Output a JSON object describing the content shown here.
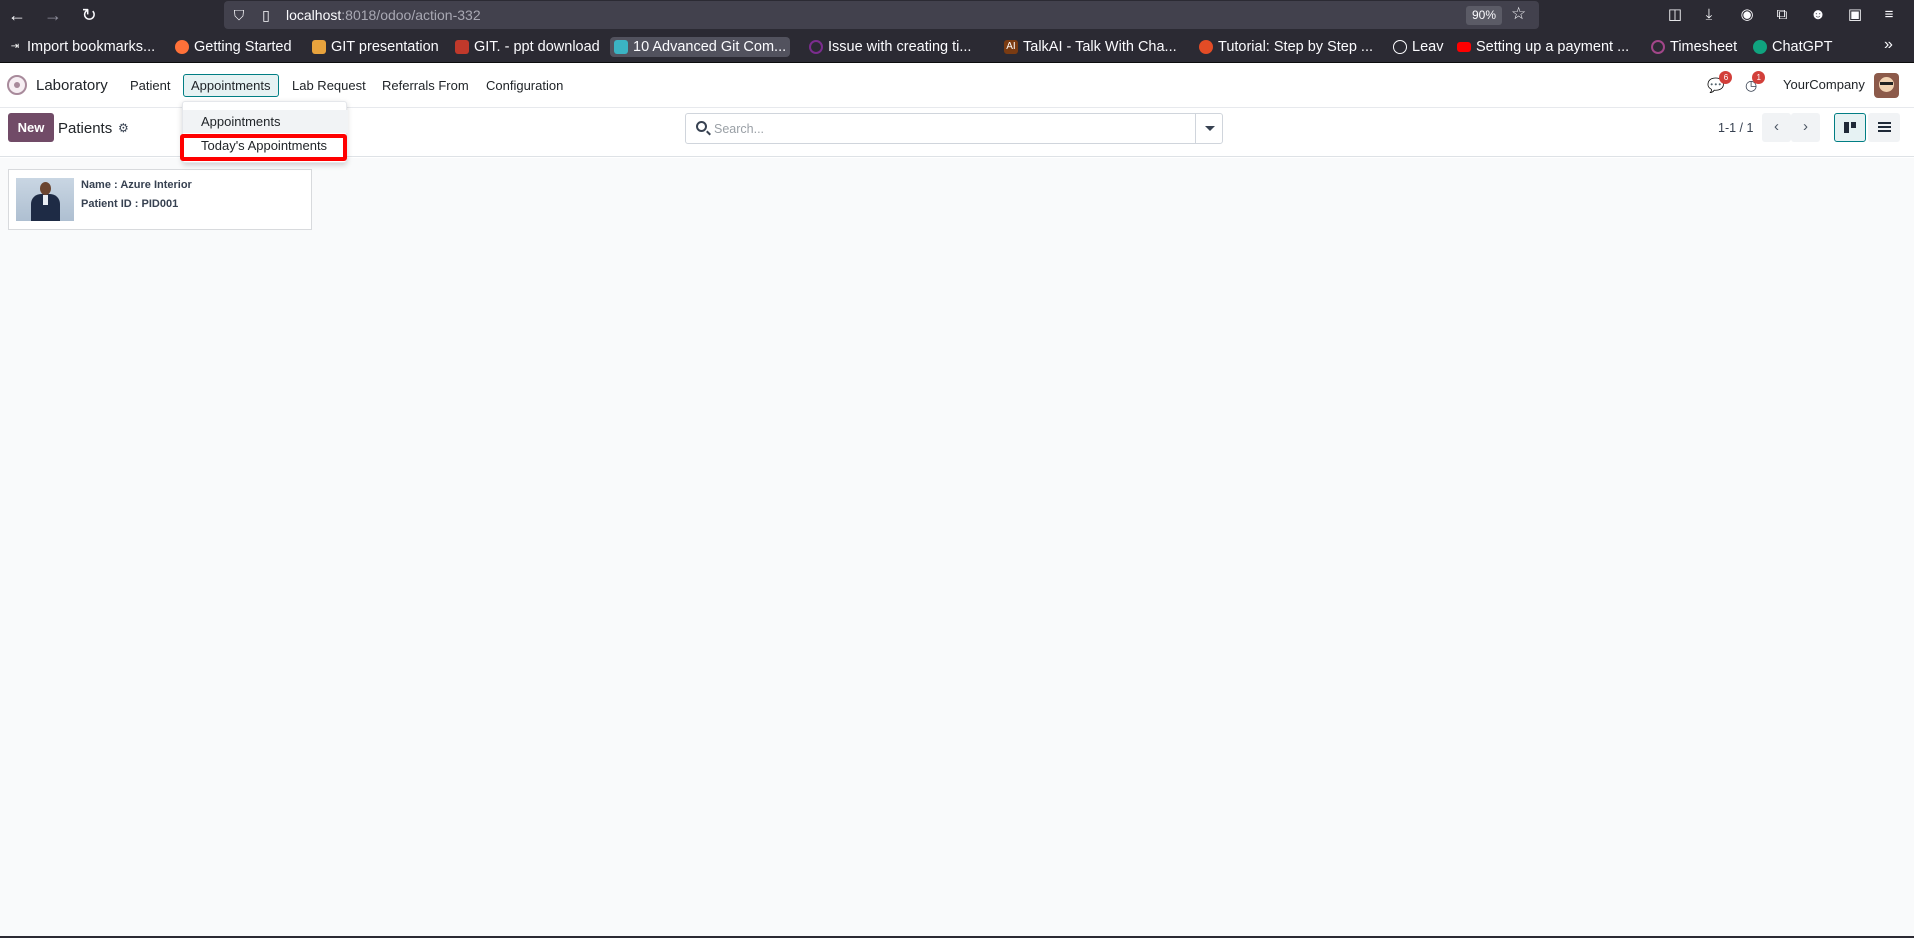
{
  "browser": {
    "url_host": "localhost",
    "url_rest": ":8018/odoo/action-332",
    "zoom": "90%"
  },
  "bookmarks": [
    {
      "label": "Import bookmarks...",
      "icon": "import-icon",
      "color": "#fbfbfe"
    },
    {
      "label": "Getting Started",
      "icon": "firefox-icon",
      "color": "#ff7139"
    },
    {
      "label": "GIT presentation",
      "icon": "git-icon",
      "color": "#e8a33d"
    },
    {
      "label": "GIT. - ppt download",
      "icon": "slides-icon",
      "color": "#c0392b"
    },
    {
      "label": "10 Advanced Git Com...",
      "icon": "article-icon",
      "color": "#3bb3c3"
    },
    {
      "label": "Issue with creating ti...",
      "icon": "forum-icon",
      "color": "#7b2d8e"
    },
    {
      "label": "TalkAI - Talk With Cha...",
      "icon": "ai-icon",
      "color": "#7a3b12"
    },
    {
      "label": "Tutorial: Step by Step ...",
      "icon": "tutorial-icon",
      "color": "#e34c26"
    },
    {
      "label": "Leav",
      "icon": "globe-icon",
      "color": "#fbfbfe"
    },
    {
      "label": "Setting up a payment ...",
      "icon": "youtube-icon",
      "color": "#ff0000"
    },
    {
      "label": "Timesheet",
      "icon": "odoo-icon",
      "color": "#a24689"
    },
    {
      "label": "ChatGPT",
      "icon": "chatgpt-icon",
      "color": "#10a37f"
    }
  ],
  "app": {
    "name": "Laboratory",
    "menus": [
      "Patient",
      "Appointments",
      "Lab Request",
      "Referrals From",
      "Configuration"
    ],
    "messages_badge": "6",
    "activities_badge": "1",
    "company": "YourCompany"
  },
  "control_panel": {
    "new_label": "New",
    "breadcrumb": "Patients",
    "search_placeholder": "Search...",
    "pager": "1-1 / 1"
  },
  "dropdown": {
    "items": [
      "Appointments",
      "Today's Appointments"
    ]
  },
  "record": {
    "name_line": "Name : Azure Interior",
    "id_line": "Patient ID : PID001"
  },
  "colors": {
    "primary": "#714b67",
    "accent": "#017e84",
    "highlight": "#ff0000"
  }
}
